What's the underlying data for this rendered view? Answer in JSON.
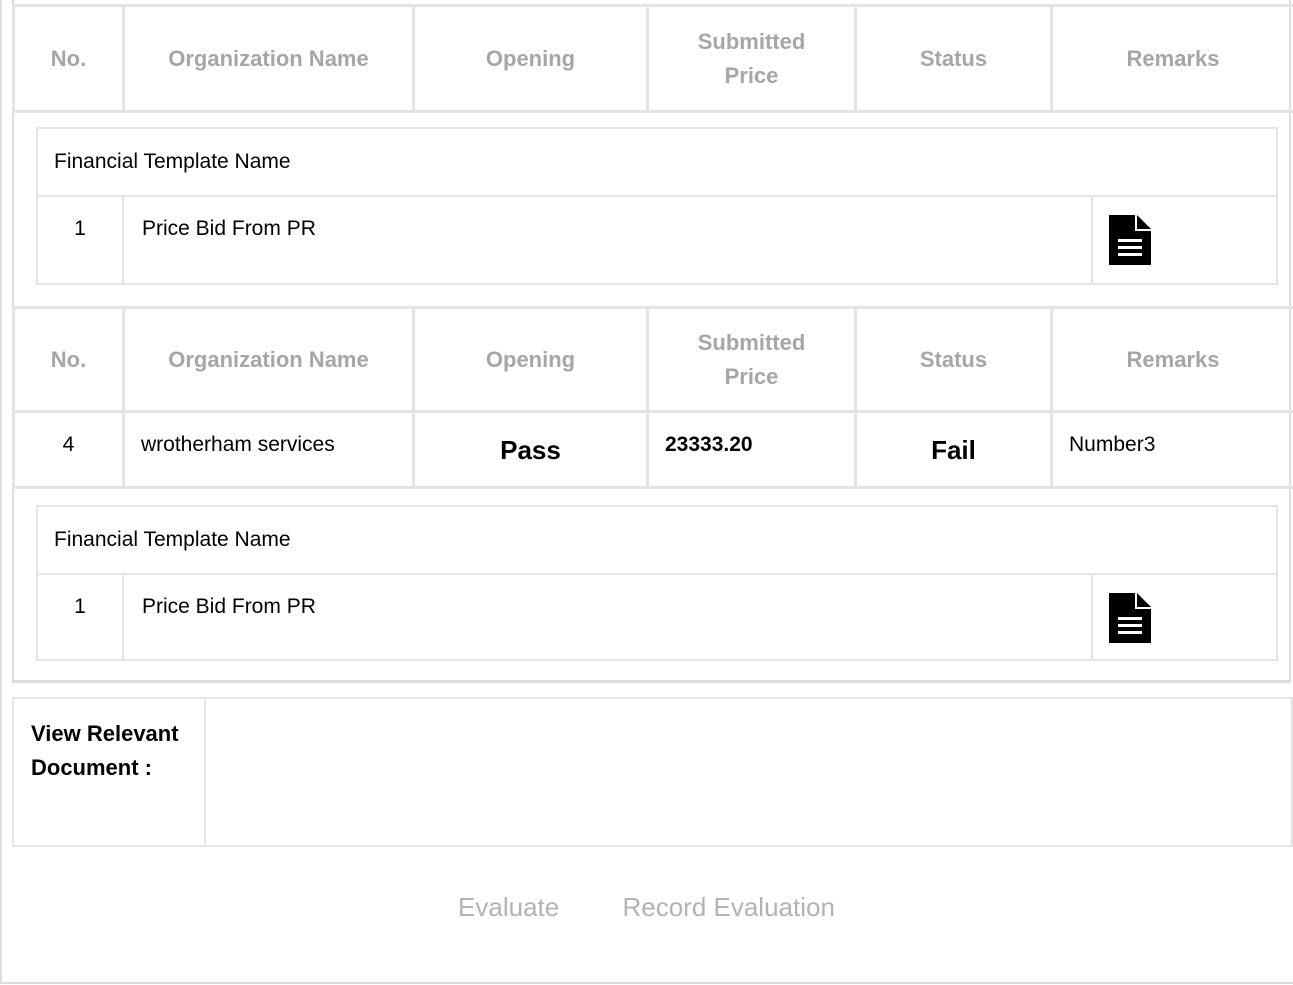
{
  "headers": [
    "No.",
    "Organization Name",
    "Opening",
    "Submitted Price",
    "Status",
    "Remarks"
  ],
  "financial_block_1": {
    "title": "Financial Template Name",
    "row": {
      "no": "1",
      "name": "Price Bid From PR",
      "icon": "document-icon"
    }
  },
  "bid_row": {
    "no": "4",
    "organization": "wrotherham services",
    "opening": "Pass",
    "submitted_price": "23333.20",
    "status": "Fail",
    "remarks": "Number3"
  },
  "financial_block_2": {
    "title": "Financial Template Name",
    "row": {
      "no": "1",
      "name": "Price Bid From PR",
      "icon": "document-icon"
    }
  },
  "view_document": {
    "label": "View Relevant Document :"
  },
  "actions": {
    "evaluate": "Evaluate",
    "record_evaluation": "Record Evaluation"
  }
}
